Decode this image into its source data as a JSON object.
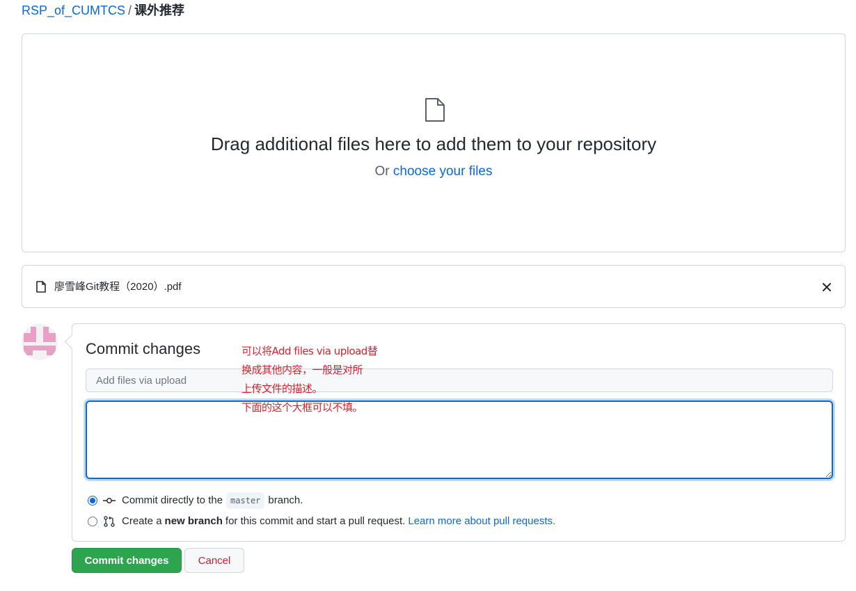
{
  "breadcrumb": {
    "repo": "RSP_of_CUMTCS",
    "separator": "/",
    "folder": "课外推荐"
  },
  "dropzone": {
    "title": "Drag additional files here to add them to your repository",
    "or_text": "Or",
    "choose_link": "choose your files"
  },
  "file": {
    "name": "廖雪峰Git教程（2020）.pdf"
  },
  "commit": {
    "heading": "Commit changes",
    "summary_placeholder": "Add files via upload",
    "description_value": "",
    "option_direct": {
      "prefix": "Commit directly to the",
      "branch": "master",
      "suffix": "branch.",
      "selected": true
    },
    "option_new": {
      "prefix": "Create a",
      "bold": "new branch",
      "suffix": "for this commit and start a pull request.",
      "link": "Learn more about pull requests.",
      "selected": false
    },
    "submit_label": "Commit changes",
    "cancel_label": "Cancel"
  },
  "annotation": {
    "lines": [
      "可以将Add files via upload替",
      "换成其他内容，一般是对所",
      "上传文件的描述。",
      "下面的这个大框可以不填。"
    ]
  },
  "colors": {
    "accent": "#0969da",
    "primary_button": "#2da44e",
    "danger": "#cf222e",
    "annotation": "#e0202a"
  }
}
